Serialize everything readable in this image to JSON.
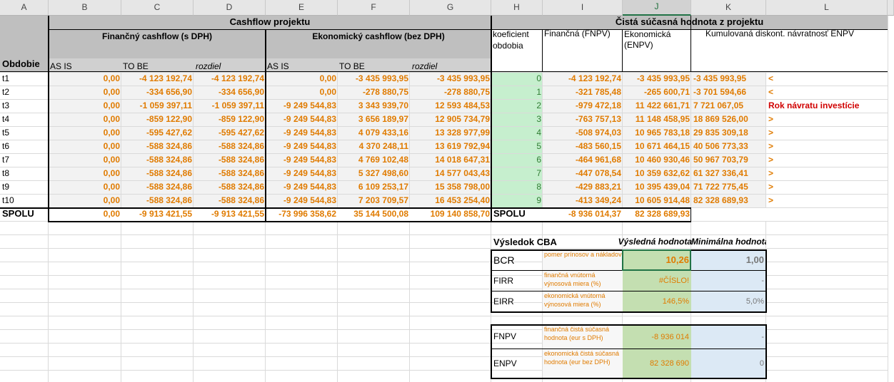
{
  "columns": [
    "A",
    "B",
    "C",
    "D",
    "E",
    "F",
    "G",
    "H",
    "I",
    "J",
    "K",
    "L"
  ],
  "active_column": "J",
  "headers": {
    "cashflow": "Cashflow projektu",
    "npv_title": "Čistá súčasná hodnota z projektu",
    "obdobie": "Obdobie",
    "financny": "Finančný cashflow (s DPH)",
    "ekonomicky": "Ekonomický cashflow (bez DPH)",
    "asis": "AS IS",
    "tobe": "TO BE",
    "rozdiel": "rozdiel",
    "koef": "koeficient obdobia",
    "fnpv": "Finančná (FNPV)",
    "enpv": "Ekonomická (ENPV)",
    "kumul": "Kumulovaná diskont. návratnosť ENPV"
  },
  "rows": [
    {
      "p": "t1",
      "b": "0,00",
      "c": "-4 123 192,74",
      "d": "-4 123 192,74",
      "e": "0,00",
      "f": "-3 435 993,95",
      "g": "-3 435 993,95",
      "h": "0",
      "i": "-4 123 192,74",
      "j": "-3 435 993,95",
      "k": "-3 435 993,95",
      "l": "<"
    },
    {
      "p": "t2",
      "b": "0,00",
      "c": "-334 656,90",
      "d": "-334 656,90",
      "e": "0,00",
      "f": "-278 880,75",
      "g": "-278 880,75",
      "h": "1",
      "i": "-321 785,48",
      "j": "-265 600,71",
      "k": "-3 701 594,66",
      "l": "<"
    },
    {
      "p": "t3",
      "b": "0,00",
      "c": "-1 059 397,11",
      "d": "-1 059 397,11",
      "e": "-9 249 544,83",
      "f": "3 343 939,70",
      "g": "12 593 484,53",
      "h": "2",
      "i": "-979 472,18",
      "j": "11 422 661,71",
      "k": "7 721 067,05",
      "l": "Rok návratu investície"
    },
    {
      "p": "t4",
      "b": "0,00",
      "c": "-859 122,90",
      "d": "-859 122,90",
      "e": "-9 249 544,83",
      "f": "3 656 189,97",
      "g": "12 905 734,79",
      "h": "3",
      "i": "-763 757,13",
      "j": "11 148 458,95",
      "k": "18 869 526,00",
      "l": ">"
    },
    {
      "p": "t5",
      "b": "0,00",
      "c": "-595 427,62",
      "d": "-595 427,62",
      "e": "-9 249 544,83",
      "f": "4 079 433,16",
      "g": "13 328 977,99",
      "h": "4",
      "i": "-508 974,03",
      "j": "10 965 783,18",
      "k": "29 835 309,18",
      "l": ">"
    },
    {
      "p": "t6",
      "b": "0,00",
      "c": "-588 324,86",
      "d": "-588 324,86",
      "e": "-9 249 544,83",
      "f": "4 370 248,11",
      "g": "13 619 792,94",
      "h": "5",
      "i": "-483 560,15",
      "j": "10 671 464,15",
      "k": "40 506 773,33",
      "l": ">"
    },
    {
      "p": "t7",
      "b": "0,00",
      "c": "-588 324,86",
      "d": "-588 324,86",
      "e": "-9 249 544,83",
      "f": "4 769 102,48",
      "g": "14 018 647,31",
      "h": "6",
      "i": "-464 961,68",
      "j": "10 460 930,46",
      "k": "50 967 703,79",
      "l": ">"
    },
    {
      "p": "t8",
      "b": "0,00",
      "c": "-588 324,86",
      "d": "-588 324,86",
      "e": "-9 249 544,83",
      "f": "5 327 498,60",
      "g": "14 577 043,43",
      "h": "7",
      "i": "-447 078,54",
      "j": "10 359 632,62",
      "k": "61 327 336,41",
      "l": ">"
    },
    {
      "p": "t9",
      "b": "0,00",
      "c": "-588 324,86",
      "d": "-588 324,86",
      "e": "-9 249 544,83",
      "f": "6 109 253,17",
      "g": "15 358 798,00",
      "h": "8",
      "i": "-429 883,21",
      "j": "10 395 439,04",
      "k": "71 722 775,45",
      "l": ">"
    },
    {
      "p": "t10",
      "b": "0,00",
      "c": "-588 324,86",
      "d": "-588 324,86",
      "e": "-9 249 544,83",
      "f": "7 203 709,57",
      "g": "16 453 254,40",
      "h": "9",
      "i": "-413 349,24",
      "j": "10 605 914,48",
      "k": "82 328 689,93",
      "l": ">"
    }
  ],
  "total": {
    "label": "SPOLU",
    "b": "0,00",
    "c": "-9 913 421,55",
    "d": "-9 913 421,55",
    "e": "-73 996 358,62",
    "f": "35 144 500,08",
    "g": "109 140 858,70",
    "h": "SPOLU",
    "i": "-8 936 014,37",
    "j": "82 328 689,93"
  },
  "cba": {
    "title": "Výsledok CBA",
    "col_result": "Výsledná hodnota",
    "col_min": "Minimálna hodnota",
    "items": [
      {
        "code": "BCR",
        "desc": "pomer prínosov a nákladov",
        "value": "10,26",
        "min": "1,00"
      },
      {
        "code": "FIRR",
        "desc": "finančná vnútorná výnosová miera (%)",
        "value": "#ČÍSLO!",
        "min": "-"
      },
      {
        "code": "EIRR",
        "desc": "ekonomická vnútorná výnosová miera (%)",
        "value": "146,5%",
        "min": "5,0%"
      },
      {
        "code": "FNPV",
        "desc": "finančná čistá súčasná hodnota (eur s DPH)",
        "value": "-8 936 014",
        "min": "-"
      },
      {
        "code": "ENPV",
        "desc": "ekonomická čistá súčasná hodnota (eur bez DPH)",
        "value": "82 328 690",
        "min": "0"
      }
    ]
  },
  "colors": {
    "orange": "#e07b00",
    "red": "#d00000",
    "gray": "#bfbfbf",
    "green": "#c6efce",
    "green_dark": "#c4dfb1",
    "blue": "#dce9f5",
    "pink": "#f2f2f2"
  }
}
